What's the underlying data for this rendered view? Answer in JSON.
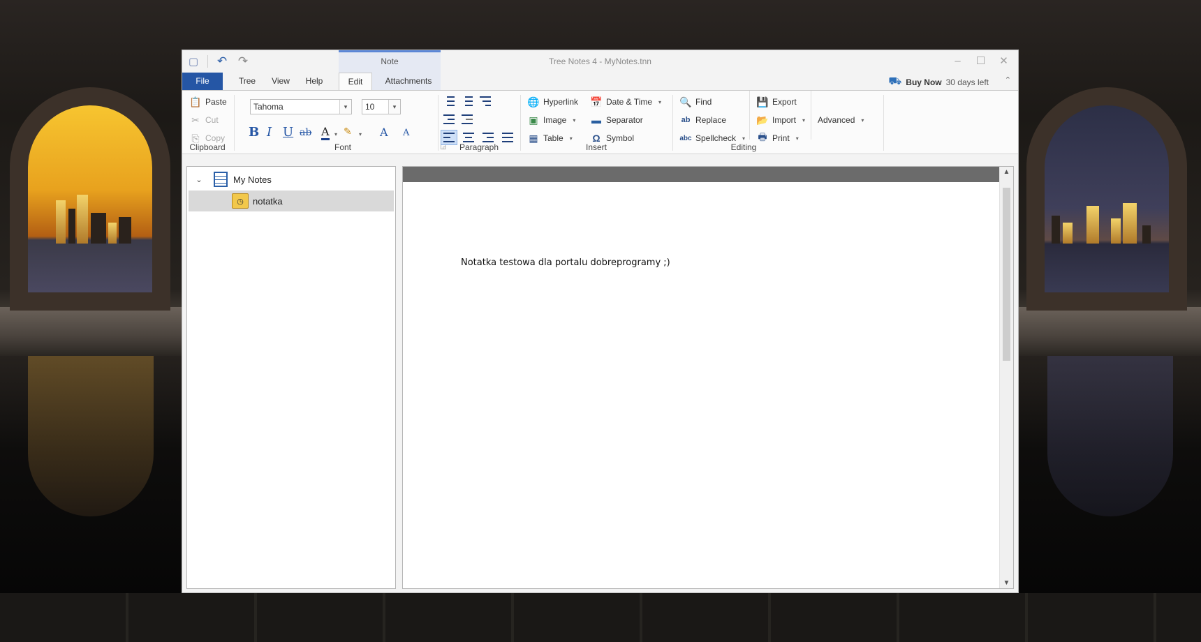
{
  "window": {
    "title": "Tree Notes 4 - MyNotes.tnn",
    "context_group_label": "Note",
    "buy_now_label": "Buy Now",
    "trial_text": "30 days left"
  },
  "tabs": [
    "File",
    "Tree",
    "View",
    "Help",
    "Edit",
    "Attachments"
  ],
  "active_tab": "Edit",
  "ribbon": {
    "clipboard": {
      "label": "Clipboard",
      "paste": "Paste",
      "cut": "Cut",
      "copy": "Copy"
    },
    "font": {
      "label": "Font",
      "family": "Tahoma",
      "size": "10"
    },
    "paragraph": {
      "label": "Paragraph"
    },
    "insert": {
      "label": "Insert",
      "hyperlink": "Hyperlink",
      "image": "Image",
      "table": "Table",
      "date_time": "Date & Time",
      "separator": "Separator",
      "symbol": "Symbol"
    },
    "editing": {
      "label": "Editing",
      "find": "Find",
      "replace": "Replace",
      "spellcheck": "Spellcheck",
      "export": "Export",
      "import": "Import",
      "print": "Print",
      "advanced": "Advanced"
    }
  },
  "tree": {
    "root": "My Notes",
    "items": [
      {
        "label": "notatka",
        "selected": true
      }
    ]
  },
  "editor": {
    "text": "Notatka testowa dla portalu dobreprogramy ;)"
  },
  "colors": {
    "file_tab": "#2556a5",
    "context_accent": "#5b86d6",
    "ribbon_bg": "#fbfbfb",
    "ruler": "#6b6b6b"
  }
}
